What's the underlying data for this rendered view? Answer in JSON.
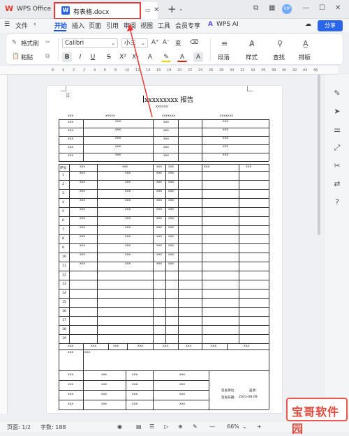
{
  "titlebar": {
    "app_name": "WPS Office",
    "tab_title": "有表格.docx"
  },
  "menu": {
    "file": "文件",
    "items": [
      "开始",
      "插入",
      "页面",
      "引用",
      "审阅",
      "视图",
      "工具",
      "会员专享"
    ],
    "wps_ai": "WPS AI",
    "share": "分享"
  },
  "ribbon": {
    "format_painter": "格式刷",
    "paste": "粘贴",
    "font_name": "Calibri",
    "font_size": "小三",
    "paragraph": "段落",
    "styles": "样式",
    "find": "查找",
    "layout": "排版"
  },
  "ruler": {
    "ticks": [
      "6",
      "4",
      "2",
      "2",
      "4",
      "6",
      "8",
      "10",
      "12",
      "14",
      "16",
      "18",
      "20",
      "22",
      "24",
      "26",
      "28",
      "30",
      "32",
      "34",
      "36",
      "38",
      "40",
      "42",
      "44",
      "46"
    ]
  },
  "document": {
    "title": "xxxxxxxxx 报告",
    "subtitle": "xxxxxx",
    "header_row": [
      "xxx",
      "xxxxx",
      "xxxxxxx",
      "xxxxxxx"
    ],
    "info_left": [
      "xxx",
      "xxx",
      "xxx",
      "xxx",
      "xxx"
    ],
    "info_left_val": [
      "xxx",
      "xxx",
      "xxx",
      "xxx",
      "xxx"
    ],
    "info_right": [
      "xxx",
      "xxx",
      "xxx",
      "xxx",
      "xxx"
    ],
    "info_right_val": [
      "xxx",
      "xxx",
      "xxx",
      "xxx",
      "xxx"
    ],
    "seq_header": "序号",
    "col_headers": [
      "xxx",
      "xxx",
      "xxx",
      "xxx",
      "xxx",
      "xxx"
    ],
    "row_numbers": [
      "1",
      "2",
      "3",
      "4",
      "5",
      "6",
      "7",
      "8",
      "9",
      "10",
      "11",
      "12",
      "13",
      "14",
      "15",
      "16",
      "17",
      "18",
      "19"
    ],
    "row_cell": "xxx",
    "summary_row": [
      "xxx",
      "xxx",
      "xxx",
      "xxx",
      "xxx",
      "xxx",
      "xxx",
      "xxx"
    ],
    "remark_label": "xxx",
    "remark_value": "xxx",
    "sign_rows": [
      "xxx",
      "xxx",
      "xxx",
      "xxx"
    ],
    "issuer_label": "签发单位:",
    "seal_label": "盖章:",
    "date_label": "签发日期:",
    "date_value": "2023-08-09"
  },
  "status": {
    "page": "页面: 1/2",
    "words": "字数: 188",
    "zoom": "66%"
  },
  "watermark": "宝哥软件园"
}
